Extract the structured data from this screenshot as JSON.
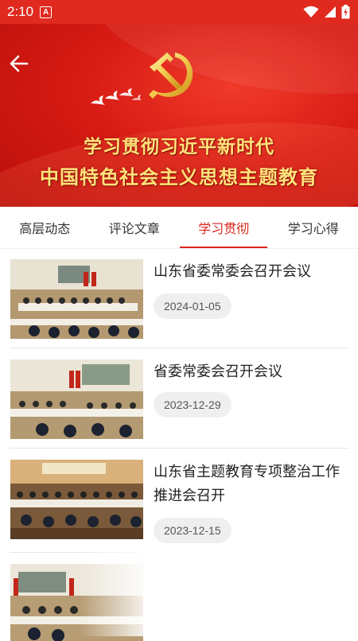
{
  "status_bar": {
    "time": "2:10",
    "a_icon": "A",
    "icons": [
      "wifi-icon",
      "signal-icon",
      "battery-icon"
    ]
  },
  "banner": {
    "title_line1": "学习贯彻习近平新时代",
    "title_line2": "中国特色社会主义思想主题教育",
    "emblem": "party-emblem-icon",
    "colors": {
      "red": "#d81c14",
      "gold": "#ffe37a"
    }
  },
  "tabs": [
    {
      "label": "高层动态",
      "active": false
    },
    {
      "label": "评论文章",
      "active": false
    },
    {
      "label": "学习贯彻",
      "active": true
    },
    {
      "label": "学习心得",
      "active": false
    }
  ],
  "articles": [
    {
      "title": "山东省委常委会召开会议",
      "date": "2024-01-05"
    },
    {
      "title": "省委常委会召开会议",
      "date": "2023-12-29"
    },
    {
      "title": "山东省主题教育专项整治工作推进会召开",
      "date": "2023-12-15"
    },
    {
      "title": "",
      "date": ""
    }
  ],
  "accent_color": "#d9251c"
}
